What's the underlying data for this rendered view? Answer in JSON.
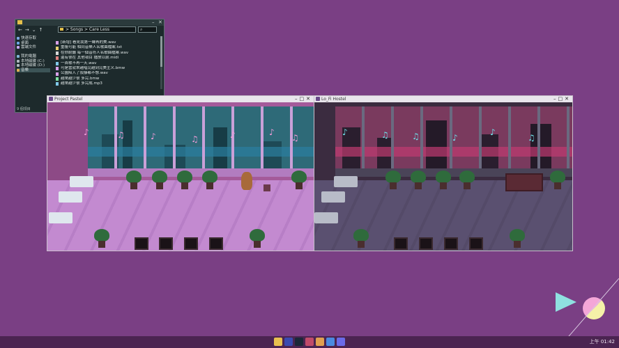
{
  "explorer": {
    "path": "> Songs > Care Less",
    "search": "",
    "nav_back": "←",
    "nav_forward": "→",
    "nav_down": "⌄",
    "nav_up": "↑",
    "sidebar": [
      {
        "label": "快速存取",
        "icon": "star-icon",
        "color": "#7aa7e0"
      },
      {
        "label": "桌面",
        "icon": "desktop-icon",
        "color": "#6aa6e6"
      },
      {
        "label": "雲端文件",
        "icon": "cloud-icon",
        "color": "#c7a7f0"
      },
      {
        "label": "",
        "icon": "",
        "color": "#1d2a2c"
      },
      {
        "label": "我的電腦",
        "icon": "computer-icon",
        "color": "#7fb4d8"
      },
      {
        "label": "本地磁碟 (C:)",
        "icon": "drive-icon",
        "color": "#b0b8c0"
      },
      {
        "label": "本地磁碟 (D:)",
        "icon": "drive-icon",
        "color": "#b0b8c0"
      },
      {
        "label": "音樂",
        "icon": "music-folder-icon",
        "color": "#e0b050"
      }
    ],
    "files": [
      {
        "name": "[新增] 看見我第一聲再的美.wav",
        "color": "#d8a0e8"
      },
      {
        "name": "重複可能 相同音樂人名歌曲檔案.txt",
        "color": "#e8d070"
      },
      {
        "name": "在你耐聽 每一個音符人名歌曲檔案.wav",
        "color": "#d8d8d8"
      },
      {
        "name": "還有很在 其他項目 播放以前.midi",
        "color": "#e08080"
      },
      {
        "name": "一首歌不再一天.wav",
        "color": "#80c8e8"
      },
      {
        "name": "可是當就來越唱完越到完美主义.bmw",
        "color": "#d8a0e8"
      },
      {
        "name": "公園陷入了寂靜都不想.wav",
        "color": "#d8a0e8"
      },
      {
        "name": "越來越少很 多完.bmw",
        "color": "#80e0a0"
      },
      {
        "name": "越來越少很 多完成.mp3",
        "color": "#80c8e8"
      }
    ],
    "status": "9 個項目"
  },
  "game_left": {
    "title": "Project Pastel"
  },
  "game_right": {
    "title": "Lo_Fi Hostel"
  },
  "taskbar": {
    "clock": "上午 01:42",
    "icons": [
      {
        "name": "file-explorer-icon",
        "color": "#e8c050"
      },
      {
        "name": "app-icon",
        "color": "#3a4ab0"
      },
      {
        "name": "steam-icon",
        "color": "#1b2838"
      },
      {
        "name": "game-icon",
        "color": "#c04a6a"
      },
      {
        "name": "paint-icon",
        "color": "#e0a050"
      },
      {
        "name": "browser-icon",
        "color": "#4a8ae0"
      },
      {
        "name": "discord-icon",
        "color": "#6a6ae8"
      }
    ]
  }
}
